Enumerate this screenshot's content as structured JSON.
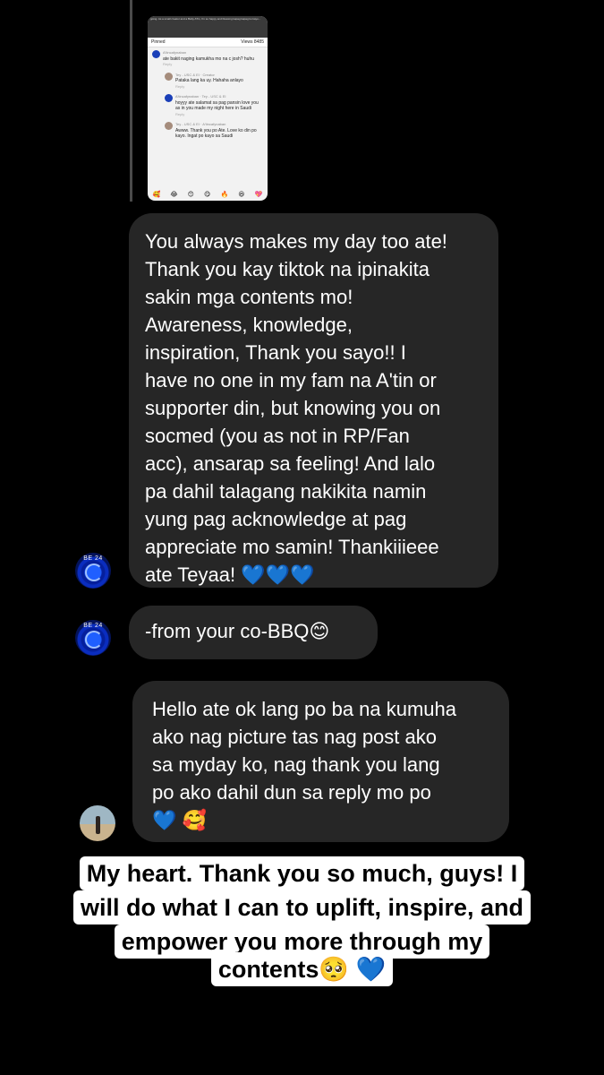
{
  "shared_screenshot": {
    "top_text": "going. As a small creator and a Baby ATin, I'm so happy and blessing kapag kapag ko kayo...",
    "bar_left": "Pinned",
    "bar_right": "Views 8485",
    "comments": [
      {
        "name": "A'tincafynaban",
        "text": "ate bakit naging kamukha mo na c josh? huhu",
        "meta": "Reply"
      },
      {
        "name": "Tey - USC & EI · Creator",
        "text": "Pataka lang ka uy. Hahaha anlayo",
        "meta": "Reply"
      },
      {
        "name": "A'tincafynaban · Tey - USC & EI",
        "text": "hoyyy ate salamat sa pag pansin love you as in you made my night here in Saudi",
        "meta": "Reply"
      },
      {
        "name": "Tey - USC & EI · A'tincafynaban",
        "text": "Awww. Thank you po Ate. Love ko din po kayo. Ingat po kayo sa Saudi",
        "meta": "Reply"
      }
    ],
    "emojis": [
      "🥰",
      "😂",
      "😊",
      "😋",
      "🔥",
      "😆",
      "💖"
    ]
  },
  "messages": [
    {
      "text": "You always makes my day too ate!\nThank you kay tiktok na ipinakita\nsakin mga contents mo!\nAwareness, knowledge,\ninspiration, Thank you sayo!! I\nhave no one in my fam na A'tin or\nsupporter din, but knowing you on\nsocmed (you as not in RP/Fan\nacc), ansarap sa feeling! And lalo\npa dahil talagang nakikita namin\nyung pag acknowledge at pag\nappreciate mo samin! Thankiiieee\nate Teyaa! 💙💙💙"
    },
    {
      "text": "-from your co-BBQ😊"
    },
    {
      "text": "Hello ate ok lang po ba na kumuha\nako nag picture tas nag post ako\nsa myday ko, nag thank you lang\npo ako dahil dun sa reply mo po\n💙 🥰"
    }
  ],
  "avatar_badge": "BE 24",
  "caption_lines": [
    "My heart. Thank you so much, guys! I",
    "will do what I can to uplift, inspire, and",
    "empower you more through my",
    "contents🥺 💙"
  ]
}
